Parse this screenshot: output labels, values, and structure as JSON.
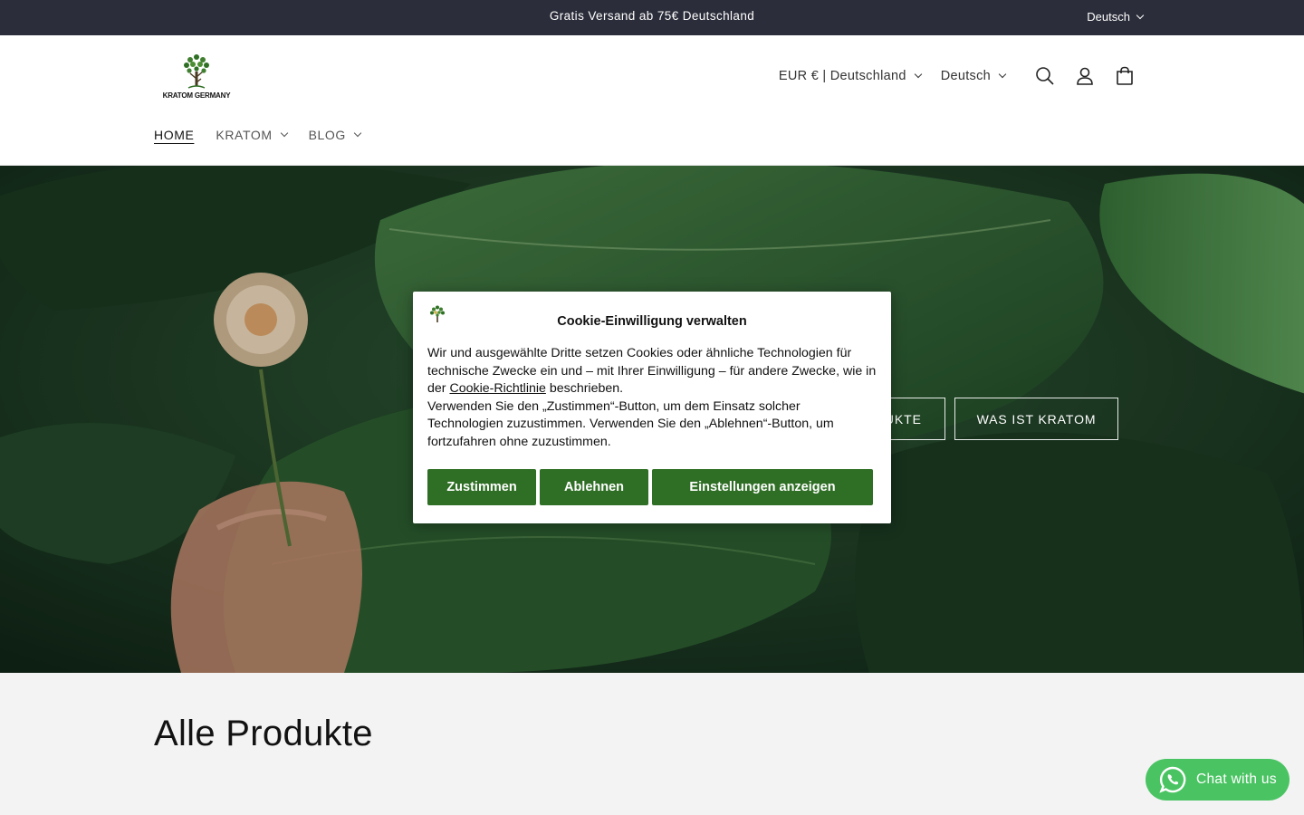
{
  "announcement": {
    "message": "Gratis Versand ab 75€ Deutschland",
    "language": "Deutsch"
  },
  "header": {
    "logo_text": "KRATOM GERMANY",
    "currency": "EUR € | Deutschland",
    "language": "Deutsch",
    "icons": [
      "search-icon",
      "account-icon",
      "cart-icon"
    ],
    "nav": [
      {
        "label": "HOME"
      },
      {
        "label": "KRATOM"
      },
      {
        "label": "BLOG"
      }
    ]
  },
  "hero": {
    "button1_label": "ALLE PRODUKTE",
    "button2_label": "WAS IST KRATOM"
  },
  "cookie": {
    "title": "Cookie-Einwilligung verwalten",
    "text_before_link": "Wir und ausgewählte Dritte setzen Cookies oder ähnliche Technologien für technische Zwecke ein und – mit Ihrer Einwilligung – für andere Zwecke, wie in der ",
    "link_text": "Cookie-Richtlinie",
    "text_after_link": " beschrieben.",
    "paragraph2": "Verwenden Sie den „Zustimmen“-Button, um dem Einsatz solcher Technologien zuzustimmen. Verwenden Sie den „Ablehnen“-Button, um fortzufahren ohne zuzustimmen.",
    "accept_label": "Zustimmen",
    "reject_label": "Ablehnen",
    "settings_label": "Einstellungen anzeigen"
  },
  "main": {
    "section_title": "Alle Produkte"
  },
  "chat": {
    "label": "Chat with us",
    "icon": "whatsapp-icon"
  },
  "colors": {
    "announcement_bg": "#2b2d3a",
    "cookie_button": "#2f6f25",
    "chat_button": "#4ac463",
    "page_bg": "#f3f3f3"
  }
}
